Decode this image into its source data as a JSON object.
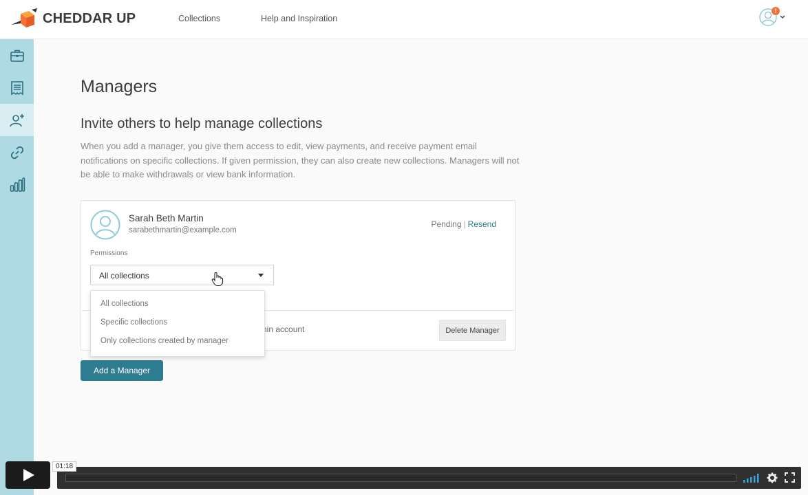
{
  "header": {
    "brand": "CHEDDAR UP",
    "nav": [
      "Collections",
      "Help and Inspiration"
    ],
    "notification_count": "!"
  },
  "sidebar": {
    "items": [
      {
        "icon": "briefcase-icon"
      },
      {
        "icon": "receipt-icon"
      },
      {
        "icon": "add-user-icon",
        "active": true
      },
      {
        "icon": "link-icon"
      },
      {
        "icon": "bar-chart-icon"
      }
    ]
  },
  "main": {
    "title": "Managers",
    "section_title": "Invite others to help manage collections",
    "intro": "When you add a manager, you give them access to edit, view payments, and receive payment email notifications on specific collections. If given permission, they can also create new collections. Managers will not be able to make withdrawals or view bank information.",
    "manager": {
      "name": "Sarah Beth Martin",
      "email": "sarabethmartin@example.com",
      "status": "Pending",
      "separator": "|",
      "resend": "Resend",
      "permissions_label": "Permissions",
      "permission_value": "All collections",
      "partial_text": "hin account",
      "delete_label": "Delete Manager"
    },
    "dropdown_options": [
      "All collections",
      "Specific collections",
      "Only collections created by manager"
    ],
    "add_button": "Add a Manager"
  },
  "player": {
    "timecode": "01:18"
  },
  "colors": {
    "sidebar": "#b0dae3",
    "accent": "#2e7c90",
    "brand_orange": "#f4713a"
  }
}
